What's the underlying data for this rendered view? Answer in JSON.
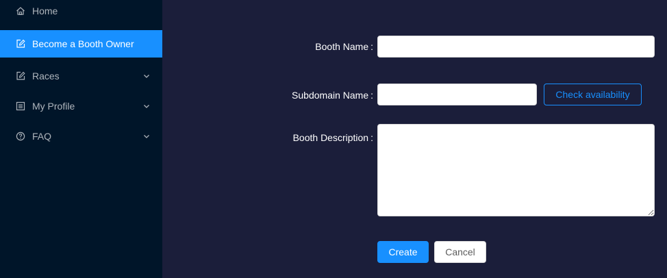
{
  "sidebar": {
    "items": [
      {
        "label": "Home",
        "icon": "home-icon"
      },
      {
        "label": "Become a Booth Owner",
        "icon": "edit-icon",
        "active": true
      },
      {
        "label": "Races",
        "icon": "edit-icon",
        "expandable": true
      },
      {
        "label": "My Profile",
        "icon": "profile-icon",
        "expandable": true
      },
      {
        "label": "FAQ",
        "icon": "question-circle-icon",
        "expandable": true
      }
    ]
  },
  "form": {
    "booth_name_label": "Booth Name",
    "booth_name_value": "",
    "subdomain_label": "Subdomain Name",
    "subdomain_value": "",
    "check_availability_label": "Check availability",
    "description_label": "Booth Description",
    "description_value": "",
    "create_label": "Create",
    "cancel_label": "Cancel",
    "label_suffix": ":"
  },
  "colors": {
    "sidebar_bg": "#001529",
    "main_bg": "#1b1e3a",
    "accent": "#1890ff"
  }
}
